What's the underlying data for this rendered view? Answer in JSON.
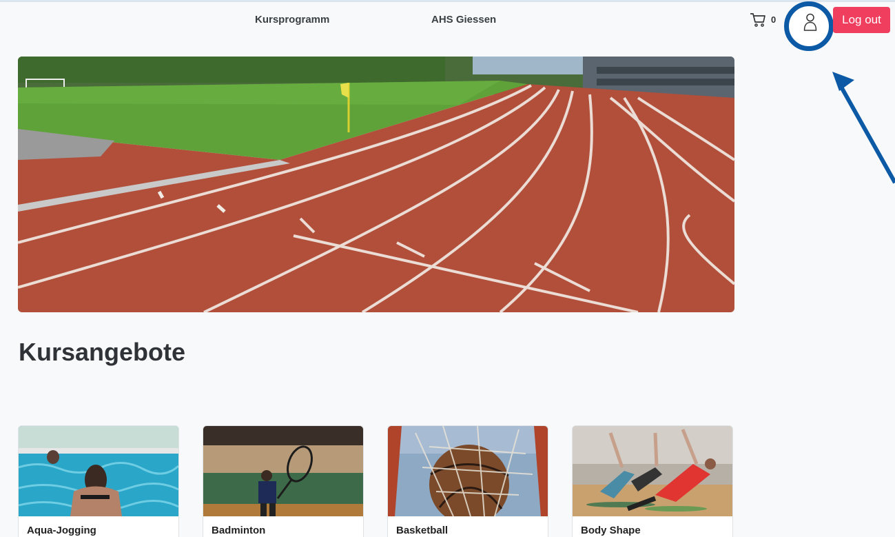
{
  "header": {
    "nav": [
      "Kursprogramm",
      "AHS Giessen"
    ],
    "cart_count": "0",
    "logout_label": "Log out"
  },
  "main": {
    "heading": "Kursangebote"
  },
  "courses": [
    {
      "title": "Aqua-Jogging"
    },
    {
      "title": "Badminton"
    },
    {
      "title": "Basketball"
    },
    {
      "title": "Body Shape"
    }
  ],
  "colors": {
    "logout": "#f03e5f",
    "annotation": "#0c5aa6",
    "background": "#f8f9fa"
  },
  "icons": [
    "cart-icon",
    "user-icon"
  ]
}
